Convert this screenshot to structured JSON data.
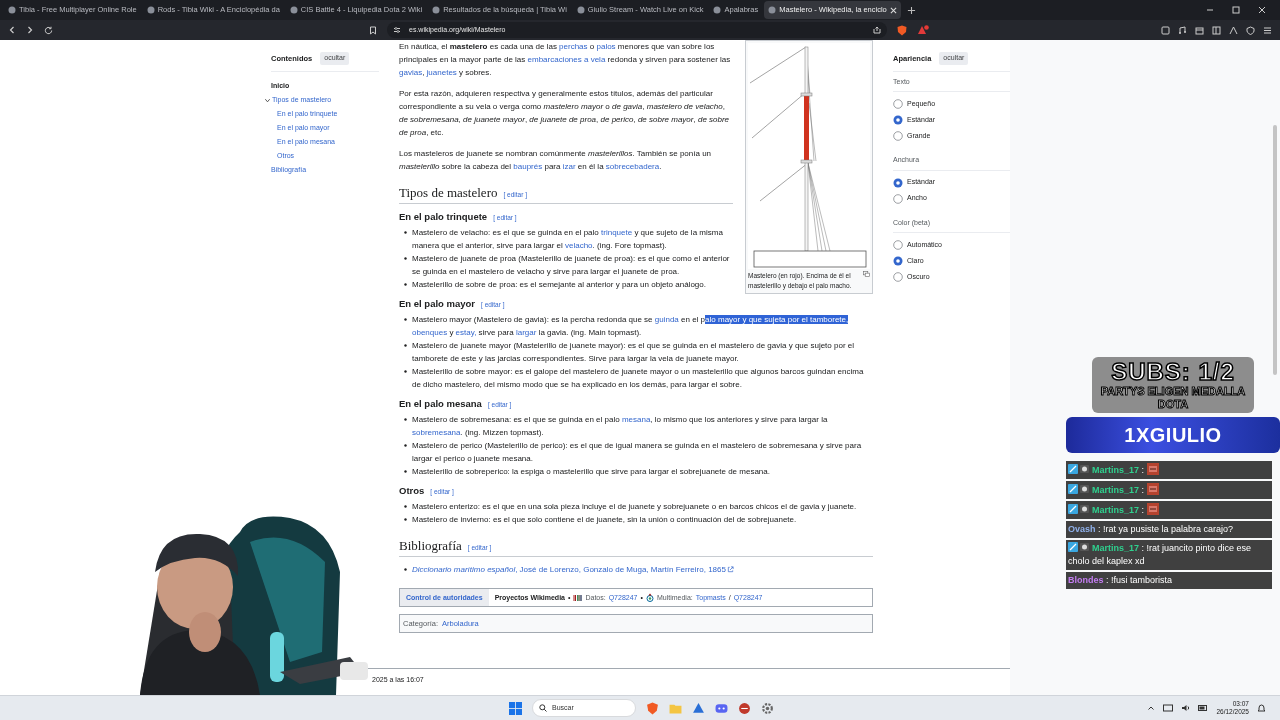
{
  "browser": {
    "tabs": [
      {
        "title": "Tibia - Free Multiplayer Online Role",
        "selected": false
      },
      {
        "title": "Rods - Tibia Wiki - A Enciclopédia da",
        "selected": false
      },
      {
        "title": "CIS Battle 4 - Liquipedia Dota 2 Wiki",
        "selected": false
      },
      {
        "title": "Resultados de la búsqueda | Tibia Wi",
        "selected": false
      },
      {
        "title": "Giulio Stream - Watch Live on Kick",
        "selected": false
      },
      {
        "title": "Apalabras",
        "selected": false
      },
      {
        "title": "Mastelero - Wikipedia, la enciclo",
        "selected": true
      }
    ],
    "url": "es.wikipedia.org/wiki/Mastelero"
  },
  "toc": {
    "title": "Contenidos",
    "hide": "ocultar",
    "items": [
      {
        "label": "Inicio",
        "selected": true
      },
      {
        "label": "Tipos de mastelero",
        "selected": false,
        "expanded": true,
        "children": [
          {
            "label": "En el palo trinquete",
            "selected": false
          },
          {
            "label": "En el palo mayor",
            "selected": false
          },
          {
            "label": "En el palo mesana",
            "selected": false
          },
          {
            "label": "Otros",
            "selected": false
          }
        ]
      },
      {
        "label": "Bibliografía",
        "selected": false
      }
    ]
  },
  "article": {
    "intro": [
      [
        "En náutica, el ",
        {
          "text": "mastelero",
          "kind": "bold"
        },
        " es cada una de las ",
        {
          "text": "perchas",
          "kind": "link"
        },
        " o ",
        {
          "text": "palos",
          "kind": "link"
        },
        " menores que van sobre los principales en la mayor parte de las ",
        {
          "text": "embarcaciones a vela",
          "kind": "link"
        },
        " redonda y sirven para sostener las ",
        {
          "text": "gavias",
          "kind": "link"
        },
        ", ",
        {
          "text": "juanetes",
          "kind": "link"
        },
        " y sobres."
      ],
      [
        "Por esta razón, adquieren respectiva y generalmente estos títulos, además del particular correspondiente a su vela o verga como ",
        {
          "text": "mastelero mayor",
          "kind": "italic"
        },
        " o ",
        {
          "text": "de gavia",
          "kind": "italic"
        },
        ", ",
        {
          "text": "mastelero de velacho",
          "kind": "italic"
        },
        ", ",
        {
          "text": "de sobremesana",
          "kind": "italic"
        },
        ", ",
        {
          "text": "de juanete mayor",
          "kind": "italic"
        },
        ", ",
        {
          "text": "de juanete de proa",
          "kind": "italic"
        },
        ", ",
        {
          "text": "de perico",
          "kind": "italic"
        },
        ", ",
        {
          "text": "de sobre mayor",
          "kind": "italic"
        },
        ", ",
        {
          "text": "de sobre de proa",
          "kind": "italic"
        },
        ", etc."
      ],
      [
        "Los masteleros de juanete se nombran comúnmente ",
        {
          "text": "mastelerillos",
          "kind": "italic"
        },
        ". También se ponía un ",
        {
          "text": "mastelerillo",
          "kind": "italic"
        },
        " sobre la cabeza del ",
        {
          "text": "bauprés",
          "kind": "link"
        },
        " para ",
        {
          "text": "izar",
          "kind": "link"
        },
        " en él la ",
        {
          "text": "sobrecebadera",
          "kind": "link"
        },
        "."
      ]
    ],
    "figure": {
      "caption": "Mastelero (en rojo). Encima de él el mastelerillo y debajo el palo macho."
    },
    "blocks": [
      {
        "kind": "h2",
        "title": "Tipos de mastelero",
        "edit": "[ editar ]"
      },
      {
        "kind": "h3",
        "title": "En el palo trinquete",
        "edit": "[ editar ]"
      },
      {
        "kind": "list",
        "items": [
          {
            "text": [
              "Mastelero de velacho: es el que se guinda en el palo ",
              {
                "text": "trinquete",
                "kind": "link"
              },
              " y que sujeto de la misma manera que el anterior, sirve para largar el ",
              {
                "text": "velacho",
                "kind": "link"
              },
              ". (ing. Fore topmast)."
            ]
          },
          {
            "text": [
              "Mastelero de juanete de proa (Mastelerillo de juanete de proa): es el que como el anterior se guinda en el mastelero de velacho y sirve para largar el juanete de proa."
            ]
          },
          {
            "text": [
              "Mastelerillo de sobre de proa: es el semejante al anterior y para un objeto análogo."
            ]
          }
        ]
      },
      {
        "kind": "h3",
        "title": "En el palo mayor",
        "edit": "[ editar ]"
      },
      {
        "kind": "list",
        "items": [
          {
            "text": [
              "Mastelero mayor (Mastelero de gavia): es la percha redonda que se ",
              {
                "text": "guinda",
                "kind": "link"
              },
              " en el p",
              {
                "text": "alo mayor y que sujeta por el tamborete, ",
                "kind": "selection"
              },
              {
                "text": "obenques",
                "kind": "link"
              },
              " y ",
              {
                "text": "estay,",
                "kind": "link"
              },
              " sirve para ",
              {
                "text": "largar",
                "kind": "link"
              },
              " la gavia. (ing. Main topmast)."
            ]
          },
          {
            "text": [
              "Mastelero de juanete mayor (Mastelerillo de juanete mayor): es el que se guinda en el mastelero de gavia y que sujeto por el tamborete de este y las jarcias correspondientes. Sirve para largar la vela de juanete mayor."
            ]
          },
          {
            "text": [
              "Mastelerillo de sobre mayor: es el galope del mastelero de juanete mayor o un mastelerillo que algunos barcos guindan encima de dicho mastelero, del mismo modo que se ha explicado en los demás, para largar el sobre."
            ]
          }
        ]
      },
      {
        "kind": "h3",
        "title": "En el palo mesana",
        "edit": "[ editar ]"
      },
      {
        "kind": "list",
        "items": [
          {
            "text": [
              "Mastelero de sobremesana: es el que se guinda en el palo ",
              {
                "text": "mesana",
                "kind": "link"
              },
              ", lo mismo que los anteriores y sirve para largar la ",
              {
                "text": "sobremesana",
                "kind": "link"
              },
              ". (ing. Mizzen topmast)."
            ]
          },
          {
            "text": [
              "Mastelero de perico (Mastelerillo de perico): es el que de igual manera se guinda en el mastelero de sobremesana y sirve para largar el perico o juanete mesana."
            ]
          },
          {
            "text": [
              "Mastelerillo de sobreperico: la espiga o mastelerillo que sirve para largar el sobrejuanete de mesana."
            ]
          }
        ]
      },
      {
        "kind": "h3",
        "title": "Otros",
        "edit": "[ editar ]"
      },
      {
        "kind": "list",
        "items": [
          {
            "text": [
              "Mastelero enterizo: es el que en una sola pieza incluye el de juanete y sobrejuanete o en barcos chicos el de gavia y juanete."
            ]
          },
          {
            "text": [
              "Mastelero de invierno: es el que solo contiene el de juanete, sin la unión o continuación del de sobrejuanete."
            ]
          }
        ]
      },
      {
        "kind": "h2",
        "title": "Bibliografía",
        "edit": "[ editar ]"
      },
      {
        "kind": "list",
        "items": [
          {
            "text": [
              {
                "text": "*Diccionario marítimo español*, José de Lorenzo, Gonzalo de Muga, Martín Ferreiro, 1865",
                "kind": "rich_link"
              }
            ],
            "external": true
          }
        ]
      }
    ],
    "authority": {
      "label": "Control de autoridades",
      "projects": "Proyectos Wikimedia",
      "entries": [
        {
          "kind": "data",
          "sep": "•",
          "label": "Datos:",
          "links": [
            "Q728247"
          ]
        },
        {
          "kind": "media",
          "sep": "•",
          "label": "Multimedia:",
          "links": [
            "Topmasts",
            "Q728247"
          ],
          "joiner": "/"
        }
      ]
    },
    "category": {
      "label": "Categoría:",
      "links": [
        "Arboladura"
      ]
    },
    "footer": {
      "last_edit": "2025 a las 16:07"
    }
  },
  "appearance": {
    "title": "Apariencia",
    "hide": "ocultar",
    "groups": [
      {
        "label": "Texto",
        "options": [
          {
            "label": "Pequeño",
            "selected": false
          },
          {
            "label": "Estándar",
            "selected": true
          },
          {
            "label": "Grande",
            "selected": false
          }
        ]
      },
      {
        "label": "Anchura",
        "options": [
          {
            "label": "Estándar",
            "selected": true
          },
          {
            "label": "Ancho",
            "selected": false
          }
        ]
      },
      {
        "label": "Color (beta)",
        "options": [
          {
            "label": "Automático",
            "selected": false
          },
          {
            "label": "Claro",
            "selected": true
          },
          {
            "label": "Oscuro",
            "selected": false
          }
        ]
      }
    ]
  },
  "stream": {
    "goal": {
      "title": "SUBS: 1/2",
      "subtitle": "PARTYS ELIGEN MEDALLA DOTA"
    },
    "banner": "1XGIULIO",
    "chat": [
      {
        "user": "Martins_17",
        "color": "#2fd08e",
        "badges": true,
        "sep": ":",
        "emote": true
      },
      {
        "user": "Martins_17",
        "color": "#2fd08e",
        "badges": true,
        "sep": ":",
        "emote": true
      },
      {
        "user": "Martins_17",
        "color": "#2fd08e",
        "badges": true,
        "sep": ":",
        "emote": true
      },
      {
        "user": "Ovash",
        "color": "#8fb0ea",
        "badges": false,
        "sep": ":",
        "message": "!rat ya pusiste la palabra carajo?",
        "emote": false
      },
      {
        "user": "Martins_17",
        "color": "#2fd08e",
        "badges": true,
        "sep": ":",
        "message": "!rat juancito pinto dice ese cholo del kaplex xd",
        "emote": false
      },
      {
        "user": "Blondes",
        "color": "#c27cf0",
        "badges": false,
        "sep": ":",
        "message": "!fusi tamborista",
        "emote": false
      }
    ]
  },
  "taskbar": {
    "search_placeholder": "Buscar",
    "time": "03:07",
    "date": "26/12/2025"
  }
}
